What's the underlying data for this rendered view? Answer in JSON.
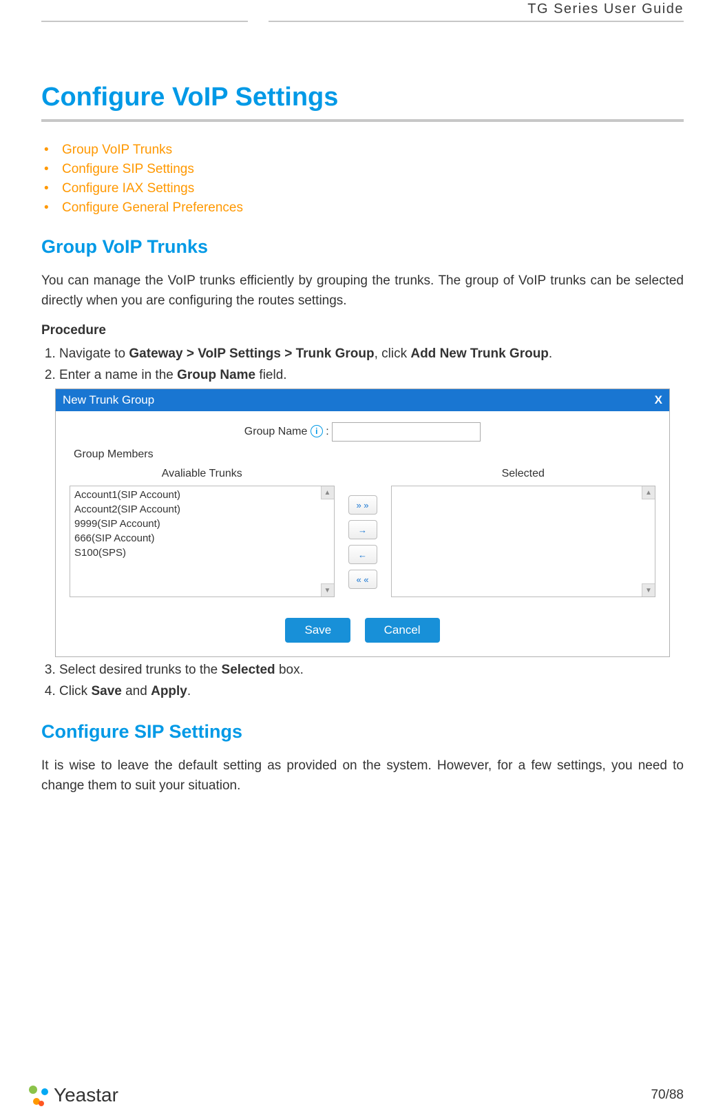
{
  "header": {
    "guide_title": "TG Series User Guide"
  },
  "main": {
    "title": "Configure VoIP Settings",
    "toc": [
      "Group VoIP Trunks",
      "Configure SIP Settings",
      "Configure IAX Settings",
      "Configure General Preferences"
    ],
    "section1": {
      "title": "Group VoIP Trunks",
      "desc": "You can manage the VoIP trunks efficiently by grouping the trunks. The group of VoIP trunks can be selected directly when you are configuring the routes settings.",
      "procedure_label": "Procedure",
      "step1_a": "Navigate to ",
      "step1_b": "Gateway > VoIP Settings > Trunk Group",
      "step1_c": ", click ",
      "step1_d": "Add New Trunk Group",
      "step1_e": ".",
      "step2_a": "Enter a name in the ",
      "step2_b": "Group Name",
      "step2_c": " field.",
      "step3_a": "Select desired trunks to the ",
      "step3_b": "Selected",
      "step3_c": " box.",
      "step4_a": "Click ",
      "step4_b": "Save",
      "step4_c": " and ",
      "step4_d": "Apply",
      "step4_e": "."
    },
    "dialog": {
      "title": "New Trunk Group",
      "close": "X",
      "group_name_label": "Group Name",
      "info_icon": "i",
      "colon": " :",
      "members_label": "Group Members",
      "available_label": "Avaliable Trunks",
      "selected_label": "Selected",
      "available_items": [
        "Account1(SIP Account)",
        "Account2(SIP Account)",
        "9999(SIP Account)",
        "666(SIP Account)",
        "S100(SPS)"
      ],
      "btn_all_right": "» »",
      "btn_right": "→",
      "btn_left": "←",
      "btn_all_left": "« «",
      "save": "Save",
      "cancel": "Cancel"
    },
    "section2": {
      "title": "Configure SIP Settings",
      "desc": "It is wise to leave the default setting as provided on the system. However, for a few settings, you need to change them to suit your situation."
    }
  },
  "footer": {
    "brand": "Yeastar",
    "page": "70/88"
  }
}
